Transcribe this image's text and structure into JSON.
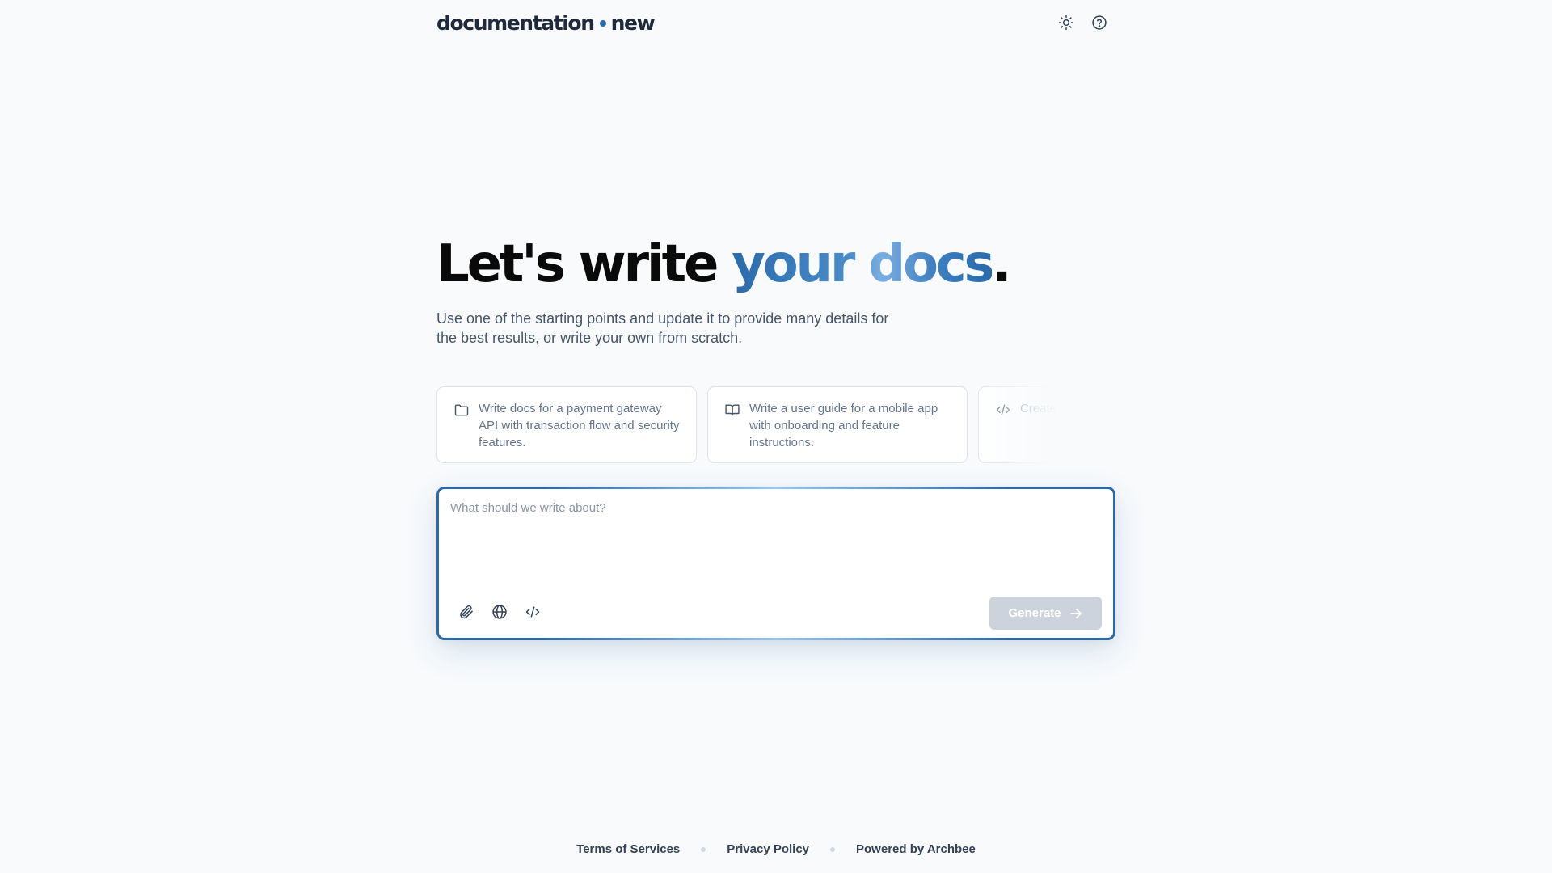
{
  "brand": {
    "logo_left": "documentation",
    "logo_right": "new",
    "accent_color": "#2a6aab"
  },
  "header": {
    "icons": [
      "sun-icon",
      "help-circle-icon"
    ]
  },
  "hero": {
    "title_prefix": "Let's write ",
    "title_accent": "your docs",
    "title_suffix": ".",
    "subtitle": "Use one of the starting points and update it to provide many details for the best results, or write your own from scratch."
  },
  "suggestions": [
    {
      "icon": "folder-icon",
      "text": "Write docs for a payment gateway API with transaction flow and security features."
    },
    {
      "icon": "book-open-icon",
      "text": "Write a user guide for a mobile app with onboarding and feature instructions."
    },
    {
      "icon": "code-icon",
      "text": "Create API weather da authenticat"
    }
  ],
  "prompt": {
    "placeholder": "What should we write about?",
    "value": "",
    "tools": [
      "paperclip-icon",
      "globe-icon",
      "code-icon"
    ],
    "generate_label": "Generate",
    "generate_disabled_color": "#cdd3dc"
  },
  "footer": {
    "links": [
      "Terms of Services",
      "Privacy Policy",
      "Powered by Archbee"
    ]
  }
}
